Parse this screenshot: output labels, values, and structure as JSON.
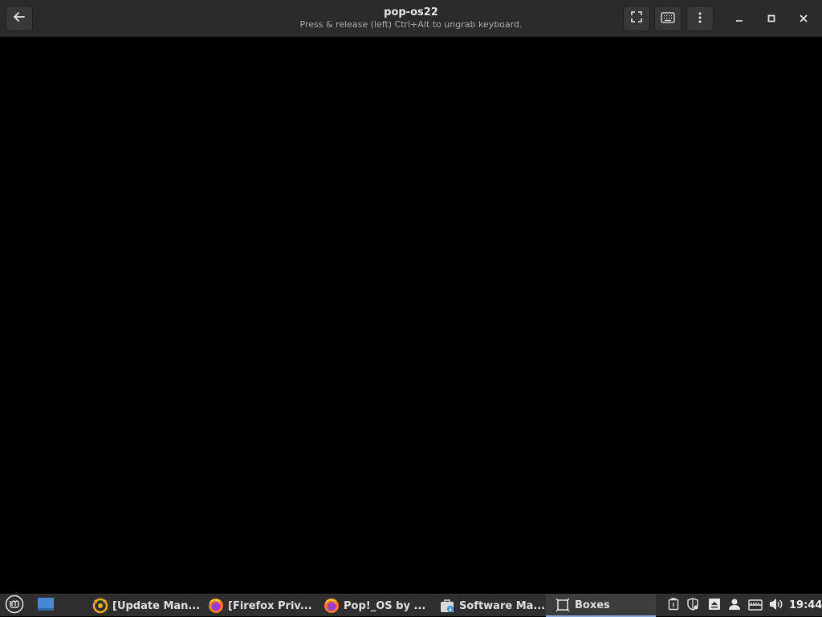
{
  "header": {
    "title": "pop-os22",
    "subtitle": "Press & release (left) Ctrl+Alt to ungrab keyboard.",
    "icons": {
      "back": "arrow-left-icon",
      "fullscreen": "fullscreen-icon",
      "keyboard": "keyboard-icon",
      "menu": "vertical-dots-icon",
      "minimize": "minimize-icon",
      "maximize": "maximize-icon",
      "close": "close-icon"
    }
  },
  "taskbar": {
    "tasks": [
      {
        "label": "[Update Man...",
        "icon": "update-manager-icon"
      },
      {
        "label": "[Firefox Priv...",
        "icon": "firefox-icon"
      },
      {
        "label": "Pop!_OS by ...",
        "icon": "firefox-icon"
      },
      {
        "label": "Software Ma...",
        "icon": "software-manager-icon"
      },
      {
        "label": "Boxes",
        "icon": "boxes-icon"
      }
    ],
    "tray": [
      "clipboard-icon",
      "shield-icon",
      "eject-icon",
      "user-icon",
      "network-icon",
      "volume-icon"
    ],
    "clock": "19:44"
  },
  "colors": {
    "headerbar": "#2b2b2b",
    "taskbar": "#2f2f2f",
    "display": "#000000",
    "active_task_underline": "#8aa8d8"
  }
}
